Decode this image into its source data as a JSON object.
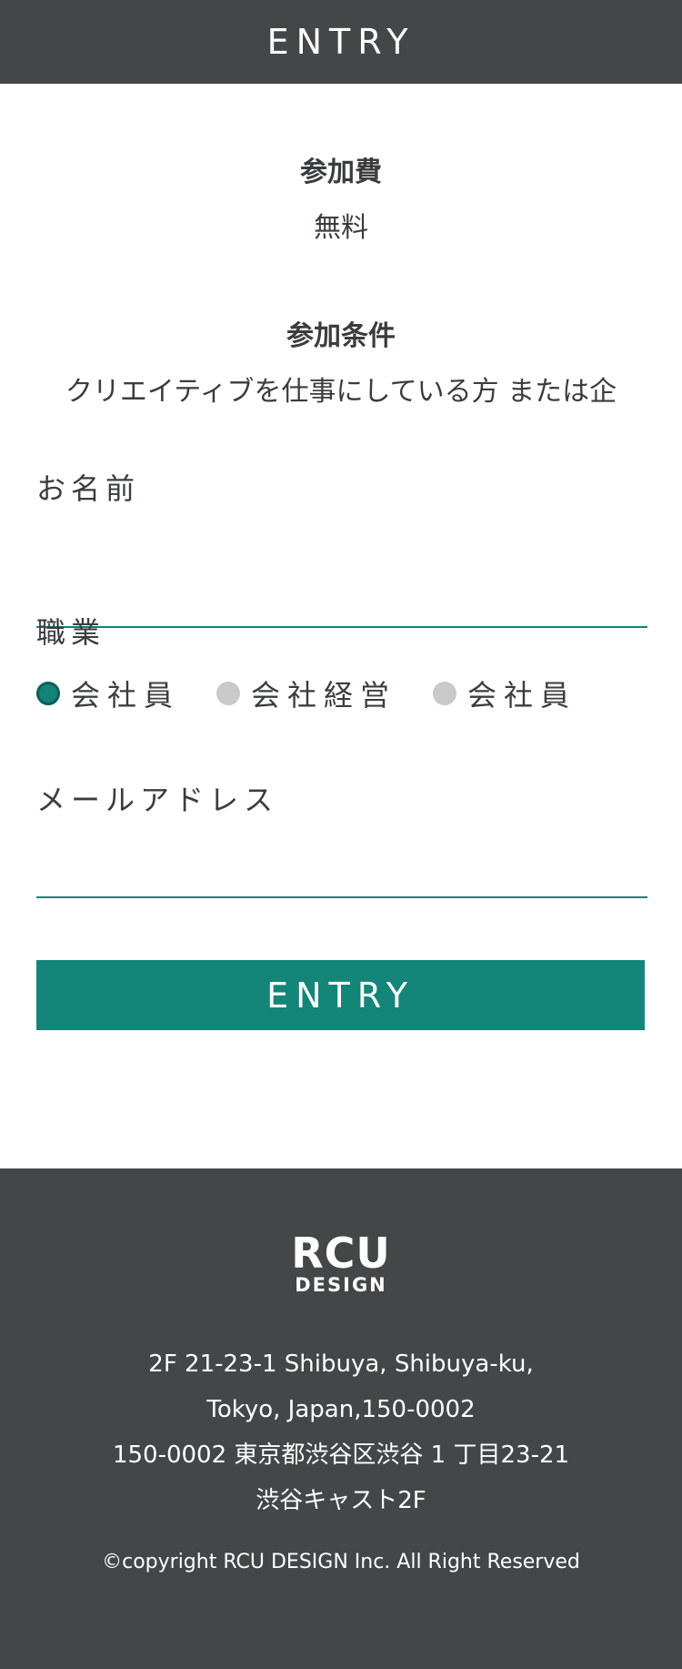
{
  "header": {
    "title": "ENTRY"
  },
  "info": {
    "fee_heading": "参加費",
    "fee_value": "無料",
    "condition_heading": "参加条件",
    "condition_value": "クリエイティブを仕事にしている方 または企"
  },
  "form": {
    "name_label": "お名前",
    "occupation_label": "職業",
    "occupation_options": [
      {
        "label": "会社員",
        "selected": true
      },
      {
        "label": "会社経営",
        "selected": false
      },
      {
        "label": "会社員",
        "selected": false
      }
    ],
    "email_label": "メールアドレス",
    "submit_label": "ENTRY"
  },
  "footer": {
    "logo_main": "RCU",
    "logo_sub": "DESIGN",
    "address_lines": [
      "2F 21-23-1 Shibuya, Shibuya-ku,",
      "Tokyo, Japan,150-0002",
      "150-0002 東京都渋谷区渋谷 1 丁目23-21",
      "渋谷キャスト2F"
    ],
    "copyright": "©copyright RCU DESIGN Inc. All Right Reserved"
  },
  "colors": {
    "accent": "#148579",
    "dark": "#434748",
    "text": "#3a3d3e",
    "radio_inactive": "#c9c9c9"
  }
}
